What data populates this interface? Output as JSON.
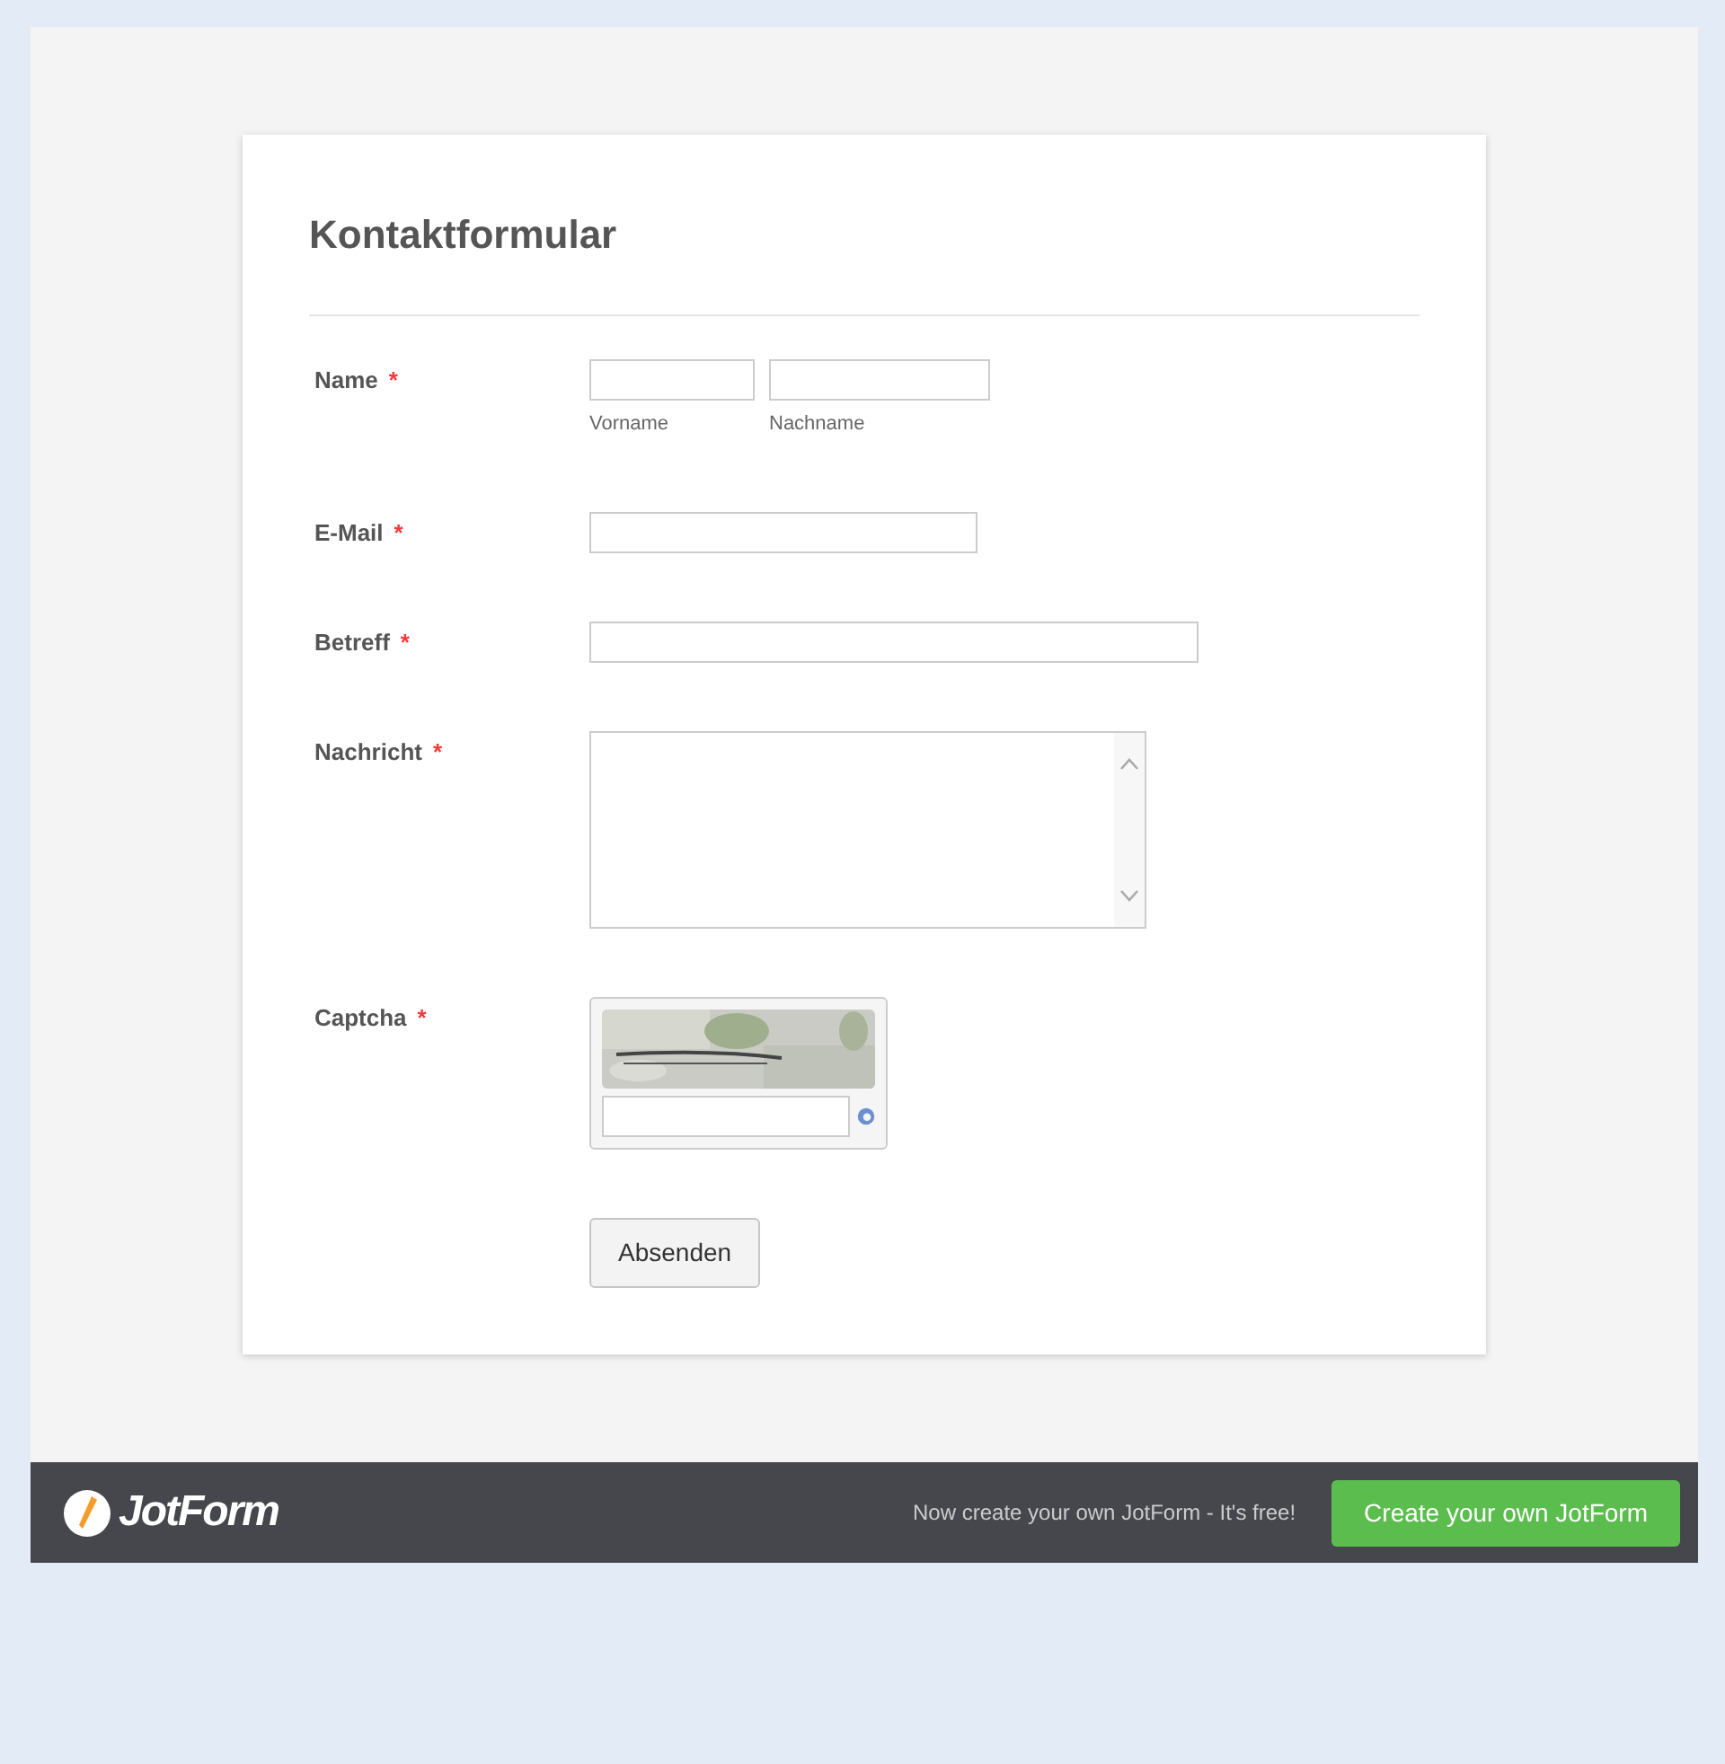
{
  "form": {
    "title": "Kontaktformular",
    "fields": [
      {
        "kind": "name",
        "label": "Name",
        "asterisk": "*",
        "sublabels": [
          "Vorname",
          "Nachname"
        ]
      },
      {
        "kind": "text",
        "label": "E-Mail",
        "asterisk": "*"
      },
      {
        "kind": "widetext",
        "label": "Betreff",
        "asterisk": "*"
      },
      {
        "kind": "textarea",
        "label": "Nachricht",
        "asterisk": "*"
      },
      {
        "kind": "captcha",
        "label": "Captcha",
        "asterisk": "*"
      }
    ],
    "submit": "Absenden"
  },
  "footer": {
    "logo": "JotForm",
    "tagline": "Now create your own JotForm - It's free!",
    "button": "Create your own JotForm"
  }
}
